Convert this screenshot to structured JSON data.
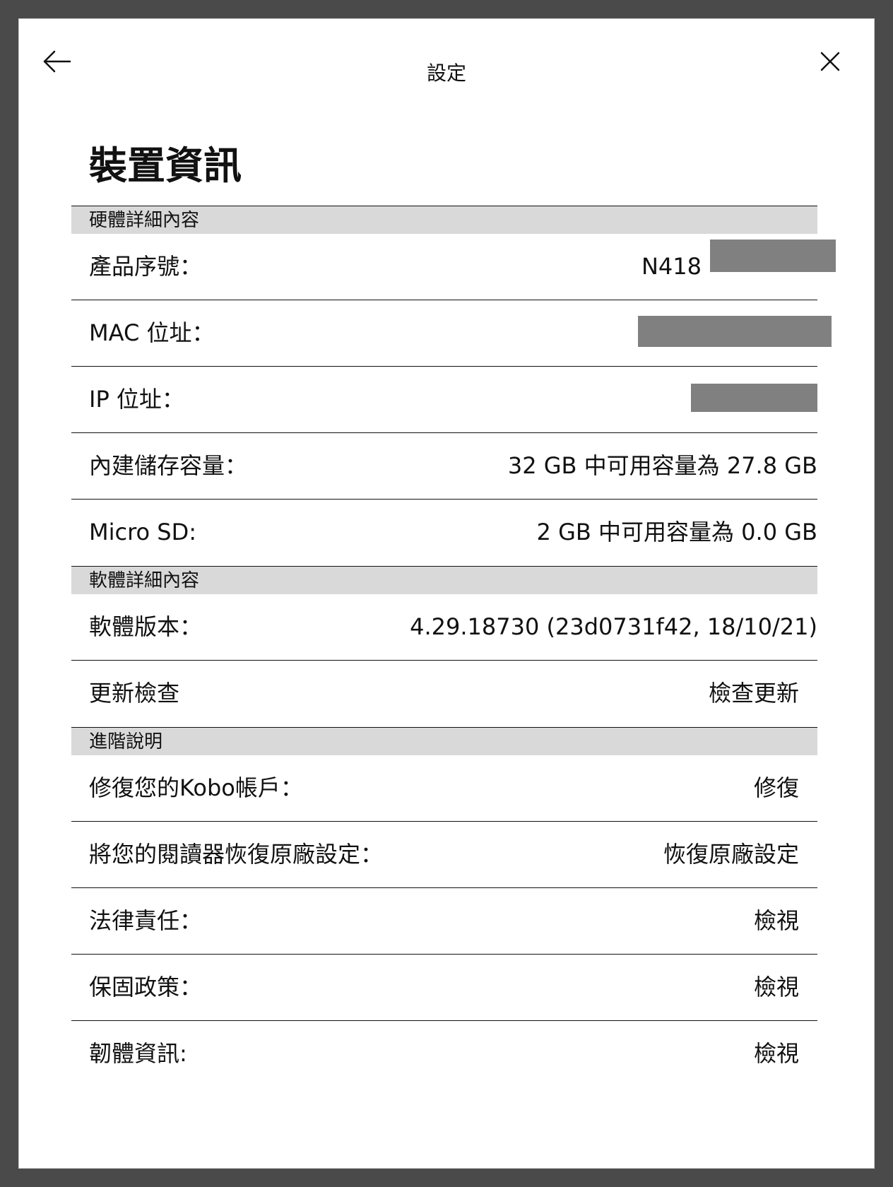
{
  "header": {
    "title": "設定",
    "back_icon": "arrow-left-icon",
    "close_icon": "close-icon"
  },
  "page_title": "裝置資訊",
  "hardware": {
    "header": "硬體詳細內容",
    "serial_label": "產品序號：",
    "serial_value": "N418",
    "mac_label": "MAC 位址：",
    "ip_label": "IP 位址：",
    "storage_label": "內建儲存容量：",
    "storage_value": "32 GB 中可用容量為 27.8 GB",
    "sd_label": "Micro SD:",
    "sd_value": "2 GB 中可用容量為 0.0 GB"
  },
  "software": {
    "header": "軟體詳細內容",
    "version_label": "軟體版本：",
    "version_value": "4.29.18730 (23d0731f42, 18/10/21)",
    "update_label": "更新檢查",
    "update_action": "檢查更新"
  },
  "advanced": {
    "header": "進階說明",
    "repair_label": "修復您的Kobo帳戶：",
    "repair_action": "修復",
    "reset_label": "將您的閱讀器恢復原廠設定：",
    "reset_action": "恢復原廠設定",
    "legal_label": "法律責任：",
    "legal_action": "檢視",
    "warranty_label": "保固政策：",
    "warranty_action": "檢視",
    "firmware_label": "韌體資訊:",
    "firmware_action": "檢視"
  },
  "colors": {
    "section_header_bg": "#d9d9d9",
    "redaction": "#808080",
    "frame": "#4a4a4a"
  }
}
